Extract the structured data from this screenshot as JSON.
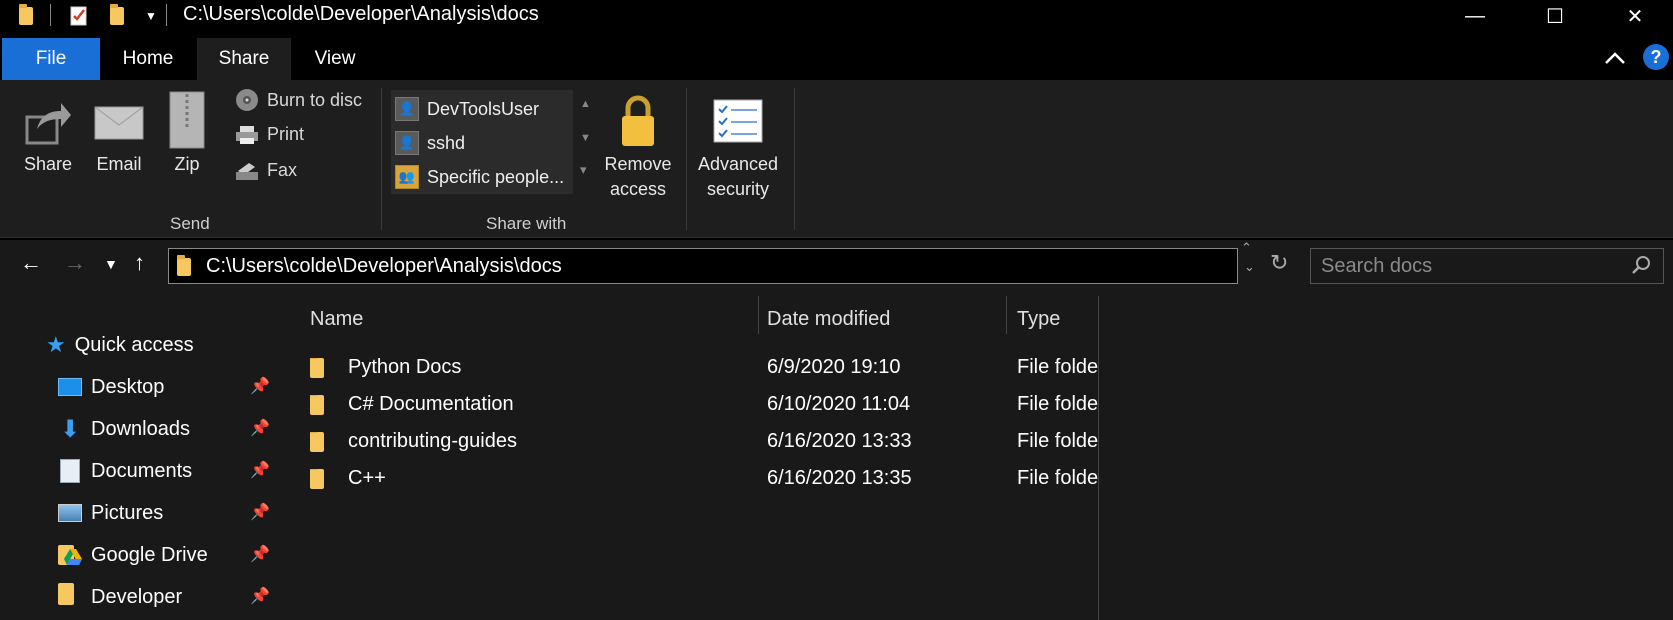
{
  "window": {
    "title": "C:\\Users\\colde\\Developer\\Analysis\\docs",
    "controls": {
      "minimize": "—",
      "maximize": "☐",
      "close": "✕"
    }
  },
  "tabs": [
    {
      "label": "File"
    },
    {
      "label": "Home"
    },
    {
      "label": "Share"
    },
    {
      "label": "View"
    }
  ],
  "ribbon": {
    "send_group": {
      "label": "Send",
      "share": "Share",
      "email": "Email",
      "zip": "Zip",
      "burn": "Burn to disc",
      "print": "Print",
      "fax": "Fax"
    },
    "share_with_group": {
      "label": "Share with",
      "items": [
        "DevToolsUser",
        "sshd",
        "Specific people..."
      ],
      "remove_access": [
        "Remove",
        "access"
      ],
      "advanced_security": [
        "Advanced",
        "security"
      ]
    }
  },
  "navigation": {
    "address": "C:\\Users\\colde\\Developer\\Analysis\\docs",
    "search_placeholder": "Search docs"
  },
  "nav_pane": {
    "quick_access": "Quick access",
    "items": [
      {
        "label": "Desktop",
        "icon": "desktop-icon"
      },
      {
        "label": "Downloads",
        "icon": "downloads-icon"
      },
      {
        "label": "Documents",
        "icon": "documents-icon"
      },
      {
        "label": "Pictures",
        "icon": "pictures-icon"
      },
      {
        "label": "Google Drive",
        "icon": "google-drive-icon"
      },
      {
        "label": "Developer",
        "icon": "folder-icon"
      }
    ]
  },
  "file_list": {
    "columns": [
      "Name",
      "Date modified",
      "Type"
    ],
    "rows": [
      {
        "name": "Python Docs",
        "date": "6/9/2020 19:10",
        "type": "File folde"
      },
      {
        "name": "C# Documentation",
        "date": "6/10/2020 11:04",
        "type": "File folde"
      },
      {
        "name": "contributing-guides",
        "date": "6/16/2020 13:33",
        "type": "File folde"
      },
      {
        "name": "C++",
        "date": "6/16/2020 13:35",
        "type": "File folde"
      }
    ]
  },
  "colors": {
    "accent": "#1a6fd6",
    "folder": "#f6c85f",
    "background": "#191919"
  }
}
